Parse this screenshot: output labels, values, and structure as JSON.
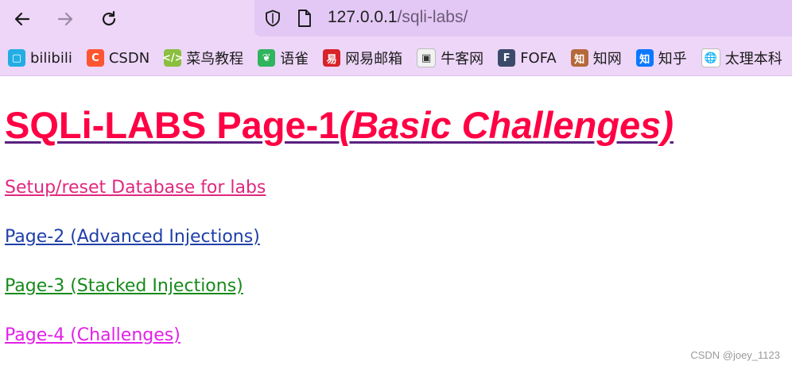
{
  "browser": {
    "url_host": "127.0.0.1",
    "url_path": "/sqli-labs/",
    "bookmarks": [
      {
        "label": "bilibili",
        "icon": "bilibili-icon",
        "color": "#23ade5",
        "glyph": "▢"
      },
      {
        "label": "CSDN",
        "icon": "csdn-icon",
        "color": "#fc5531",
        "glyph": "C"
      },
      {
        "label": "菜鸟教程",
        "icon": "runoob-icon",
        "color": "#8bbf3f",
        "glyph": "</>"
      },
      {
        "label": "语雀",
        "icon": "yuque-icon",
        "color": "#30b45d",
        "glyph": "❦"
      },
      {
        "label": "网易邮箱",
        "icon": "netease-mail-icon",
        "color": "#d8232a",
        "glyph": "易"
      },
      {
        "label": "牛客网",
        "icon": "nowcoder-icon",
        "color": "#f2f2f2",
        "glyph": "▣"
      },
      {
        "label": "FOFA",
        "icon": "fofa-icon",
        "color": "#3b4a6b",
        "glyph": "F"
      },
      {
        "label": "知网",
        "icon": "cnki-icon",
        "color": "#b5693a",
        "glyph": "知"
      },
      {
        "label": "知乎",
        "icon": "zhihu-icon",
        "color": "#0b78ff",
        "glyph": "知"
      },
      {
        "label": "太理本科",
        "icon": "globe-icon",
        "color": "#ffffff",
        "glyph": "🌐"
      }
    ]
  },
  "page": {
    "title_main": "SQLi-LABS Page-1",
    "title_sub": "(Basic Challenges)",
    "title_color": "#ff0044",
    "links": [
      {
        "label": "Setup/reset Database for labs",
        "color": "#e0287f"
      },
      {
        "label": "Page-2 (Advanced Injections)",
        "color": "#1f3fa8"
      },
      {
        "label": "Page-3 (Stacked Injections)",
        "color": "#178a1a"
      },
      {
        "label": "Page-4 (Challenges)",
        "color": "#e221e8"
      }
    ]
  },
  "watermark": "CSDN @joey_1123"
}
